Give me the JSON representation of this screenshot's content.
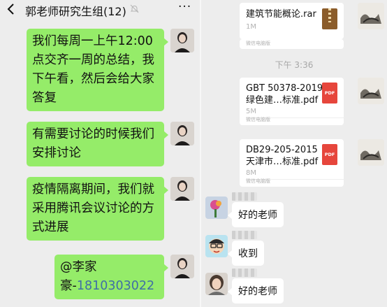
{
  "header": {
    "title": "郭老师研究生组(12)",
    "more_label": "···"
  },
  "left_messages": [
    {
      "text": "我们每周一上午12:00点交齐一周的总结，我下午看，然后会给大家答复"
    },
    {
      "text": "有需要讨论的时候我们安排讨论"
    },
    {
      "text": "疫情隔离期间，我们就采用腾讯会议讨论的方式进展"
    },
    {
      "mention": "@李家豪-",
      "phone": "1810303022"
    }
  ],
  "right_pane": {
    "files": [
      {
        "name_line1": "建筑节能概论.rar",
        "name_line2": "",
        "size": "1M",
        "source": "微信电脑版",
        "type": "rar"
      },
      {
        "name_line1": "GBT 50378-2019",
        "name_line2": "绿色建…标准.pdf",
        "size": "5M",
        "source": "微信电脑版",
        "type": "pdf",
        "icon_label": "PDF"
      },
      {
        "name_line1": "DB29-205-2015",
        "name_line2": "天津市…标准.pdf",
        "size": "8M",
        "source": "微信电脑版",
        "type": "pdf",
        "icon_label": "PDF"
      }
    ],
    "timestamp": "下午 3:36",
    "replies": [
      {
        "text": "好的老师"
      },
      {
        "text": "收到"
      },
      {
        "text": "好的老师"
      }
    ]
  },
  "colors": {
    "sent_bubble": "#95ec69",
    "received_bubble": "#ffffff",
    "background": "#ededed",
    "link": "#3f6ea6",
    "pdf_icon": "#e6463c"
  }
}
